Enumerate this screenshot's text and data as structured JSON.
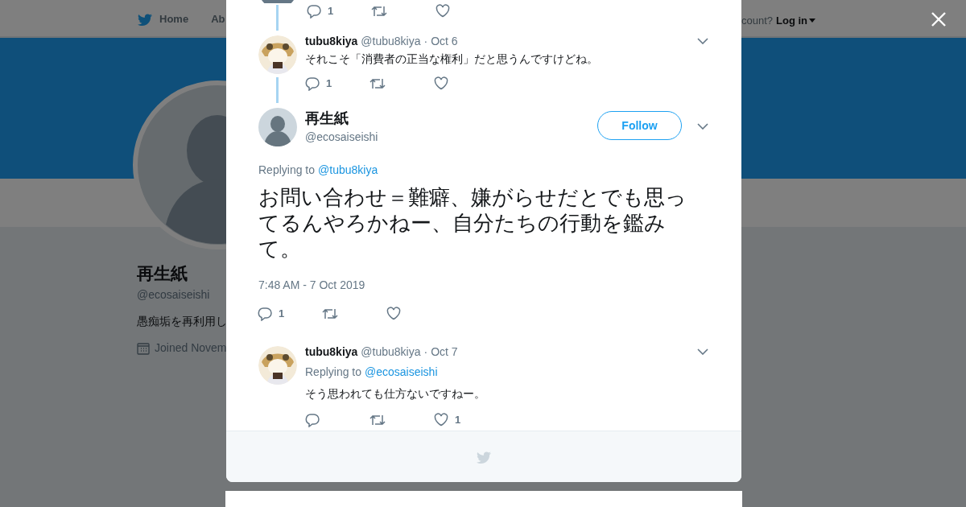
{
  "background_page": {
    "nav": [
      {
        "label": "Home"
      },
      {
        "label": "Ab"
      }
    ],
    "login_prompt": "count?",
    "login_link": "Log in",
    "profile": {
      "name": "再生紙",
      "handle": "@ecosaiseishi",
      "bio": "愚痴垢を再利用し",
      "joined": "Joined Novem"
    }
  },
  "modal": {
    "thread": [
      {
        "kind": "cut",
        "reply_count": "1"
      },
      {
        "kind": "reply",
        "name": "tubu8kiya",
        "handle": "@tubu8kiya",
        "separator": "·",
        "date": "Oct 6",
        "text": "それこそ「消費者の正当な権利」だと思うんですけどね。",
        "reply_count": "1"
      }
    ],
    "main_tweet": {
      "name": "再生紙",
      "handle": "@ecosaiseishi",
      "follow_button": "Follow",
      "replying_label": "Replying to",
      "replying_to": "@tubu8kiya",
      "text": "お問い合わせ＝難癖、嫌がらせだとでも思ってるんやろかねー、自分たちの行動を鑑みて。",
      "time": "7:48 AM - 7 Oct 2019",
      "reply_count": "1"
    },
    "replies": [
      {
        "name": "tubu8kiya",
        "handle": "@tubu8kiya",
        "separator": "·",
        "date": "Oct 7",
        "replying_label": "Replying to",
        "replying_to": "@ecosaiseishi",
        "text": "そう思われても仕方ないですねー。",
        "like_count": "1"
      }
    ]
  }
}
